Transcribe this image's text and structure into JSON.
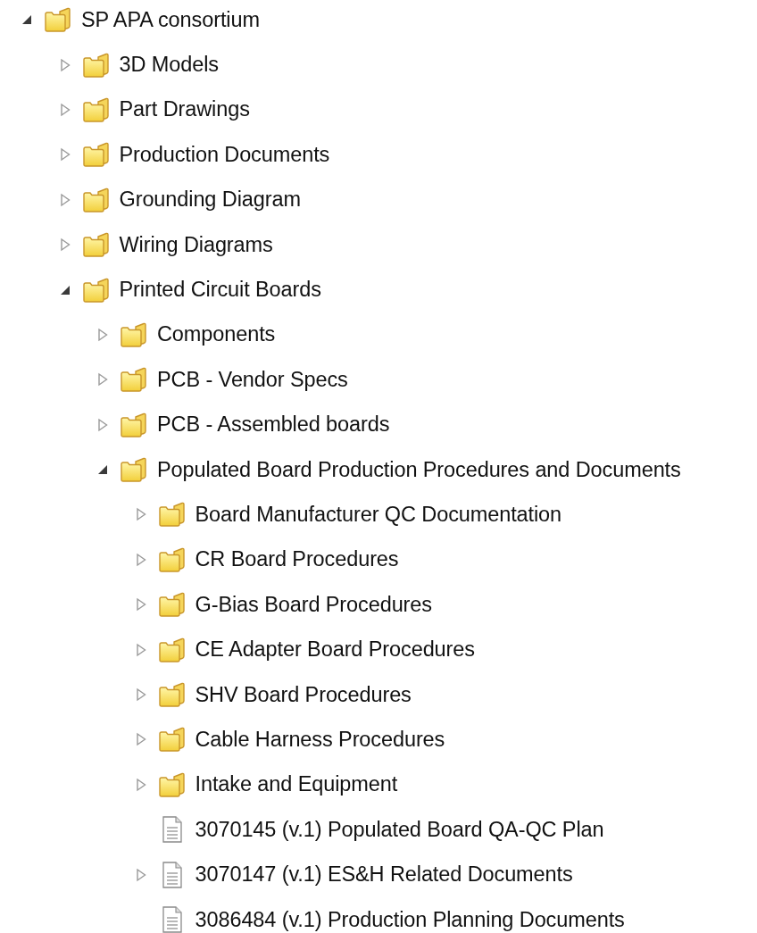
{
  "tree": [
    {
      "label": "SP APA consortium",
      "kind": "folder",
      "expanded": true,
      "children": [
        {
          "label": "3D Models",
          "kind": "folder",
          "expanded": false
        },
        {
          "label": "Part Drawings",
          "kind": "folder",
          "expanded": false
        },
        {
          "label": "Production Documents",
          "kind": "folder",
          "expanded": false
        },
        {
          "label": "Grounding Diagram",
          "kind": "folder",
          "expanded": false
        },
        {
          "label": "Wiring Diagrams",
          "kind": "folder",
          "expanded": false
        },
        {
          "label": "Printed Circuit Boards",
          "kind": "folder",
          "expanded": true,
          "children": [
            {
              "label": "Components",
              "kind": "folder",
              "expanded": false
            },
            {
              "label": "PCB - Vendor Specs",
              "kind": "folder",
              "expanded": false
            },
            {
              "label": "PCB - Assembled boards",
              "kind": "folder",
              "expanded": false
            },
            {
              "label": "Populated Board Production Procedures and Documents",
              "kind": "folder",
              "expanded": true,
              "children": [
                {
                  "label": "Board Manufacturer QC Documentation",
                  "kind": "folder",
                  "expanded": false
                },
                {
                  "label": "CR Board Procedures",
                  "kind": "folder",
                  "expanded": false
                },
                {
                  "label": "G-Bias Board Procedures",
                  "kind": "folder",
                  "expanded": false
                },
                {
                  "label": "CE Adapter Board Procedures",
                  "kind": "folder",
                  "expanded": false
                },
                {
                  "label": "SHV Board Procedures",
                  "kind": "folder",
                  "expanded": false
                },
                {
                  "label": "Cable Harness Procedures",
                  "kind": "folder",
                  "expanded": false
                },
                {
                  "label": "Intake and Equipment",
                  "kind": "folder",
                  "expanded": false
                },
                {
                  "label": "3070145 (v.1) Populated Board QA-QC Plan",
                  "kind": "document"
                },
                {
                  "label": "3070147 (v.1) ES&H Related Documents",
                  "kind": "document",
                  "expanded": false
                },
                {
                  "label": "3086484 (v.1) Production Planning Documents",
                  "kind": "document"
                }
              ]
            }
          ]
        }
      ]
    }
  ]
}
